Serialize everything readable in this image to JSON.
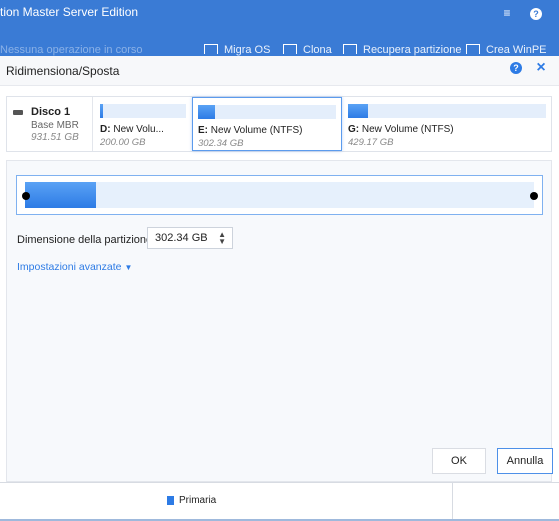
{
  "app": {
    "title": "tion Master Server Edition",
    "toolbar": {
      "faded_item": "Nessuna operazione in corso",
      "items": [
        "Migra OS",
        "Clona",
        "Recupera partizione",
        "Crea WinPE"
      ]
    }
  },
  "dialog": {
    "title": "Ridimensiona/Sposta",
    "disk": {
      "name": "Disco 1",
      "type": "Base MBR",
      "size": "931.51 GB"
    },
    "partitions": [
      {
        "letter": "D:",
        "name": "New Volu...",
        "size": "200.00 GB",
        "used_fraction": 0.04,
        "selected": false
      },
      {
        "letter": "E:",
        "name": "New Volume (NTFS)",
        "size": "302.34 GB",
        "used_fraction": 0.12,
        "selected": true
      },
      {
        "letter": "G:",
        "name": "New Volume (NTFS)",
        "size": "429.17 GB",
        "used_fraction": 0.1,
        "selected": false
      }
    ],
    "slider": {
      "used_fraction": 0.14
    },
    "size_field": {
      "label": "Dimensione della partizione:",
      "value": "302.34 GB"
    },
    "advanced_label": "Impostazioni avanzate",
    "ok_label": "OK",
    "cancel_label": "Annulla"
  },
  "status": {
    "legend_primary": "Primaria"
  },
  "colors": {
    "accent": "#2d7be5",
    "titlebar": "#3a7bd5"
  }
}
